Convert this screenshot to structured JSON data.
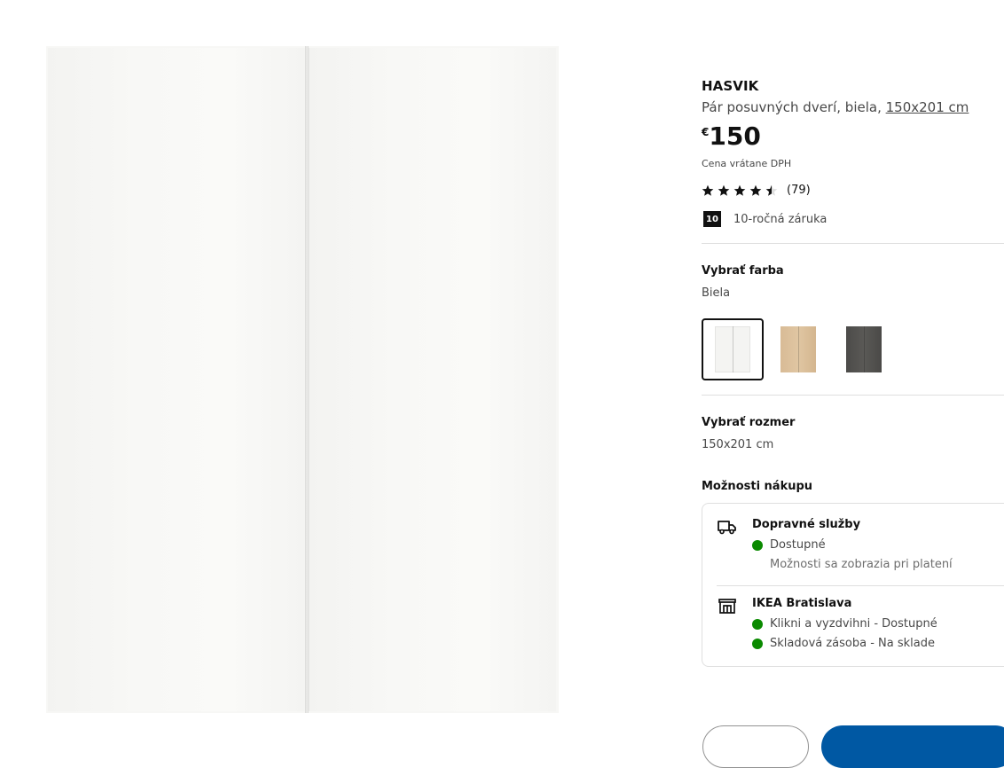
{
  "product": {
    "name": "HASVIK",
    "description": "Pár posuvných dverí, biela, ",
    "size_link": "150x201 cm",
    "currency": "€",
    "price": "150",
    "vat_note": "Cena vrátane DPH",
    "rating": 4.5,
    "rating_max": 5,
    "review_count": "(79)",
    "warranty_badge": "10",
    "warranty_text": "10-ročná záruka"
  },
  "color_selector": {
    "title": "Vybrať farba",
    "selected_value": "Biela",
    "options": [
      {
        "name": "white",
        "color": "#f4f4f2",
        "selected": true
      },
      {
        "name": "white-stained-oak",
        "color": "#dcc09b",
        "selected": false
      },
      {
        "name": "dark-grey",
        "color": "#52514f",
        "selected": false
      }
    ]
  },
  "size_selector": {
    "title": "Vybrať rozmer",
    "selected_value": "150x201 cm"
  },
  "purchase_options": {
    "title": "Možnosti nákupu",
    "delivery": {
      "icon": "truck-icon",
      "title": "Dopravné služby",
      "status": "Dostupné",
      "note": "Možnosti sa zobrazia pri platení",
      "status_color": "#0a8a00"
    },
    "store": {
      "icon": "store-icon",
      "title": "IKEA Bratislava",
      "click_collect": "Klikni a vyzdvihni - Dostupné",
      "stock": "Skladová zásoba - Na sklade",
      "status_color": "#0a8a00"
    }
  },
  "colors": {
    "primary_button": "#0058a3",
    "text": "#111111",
    "muted": "#484848"
  }
}
